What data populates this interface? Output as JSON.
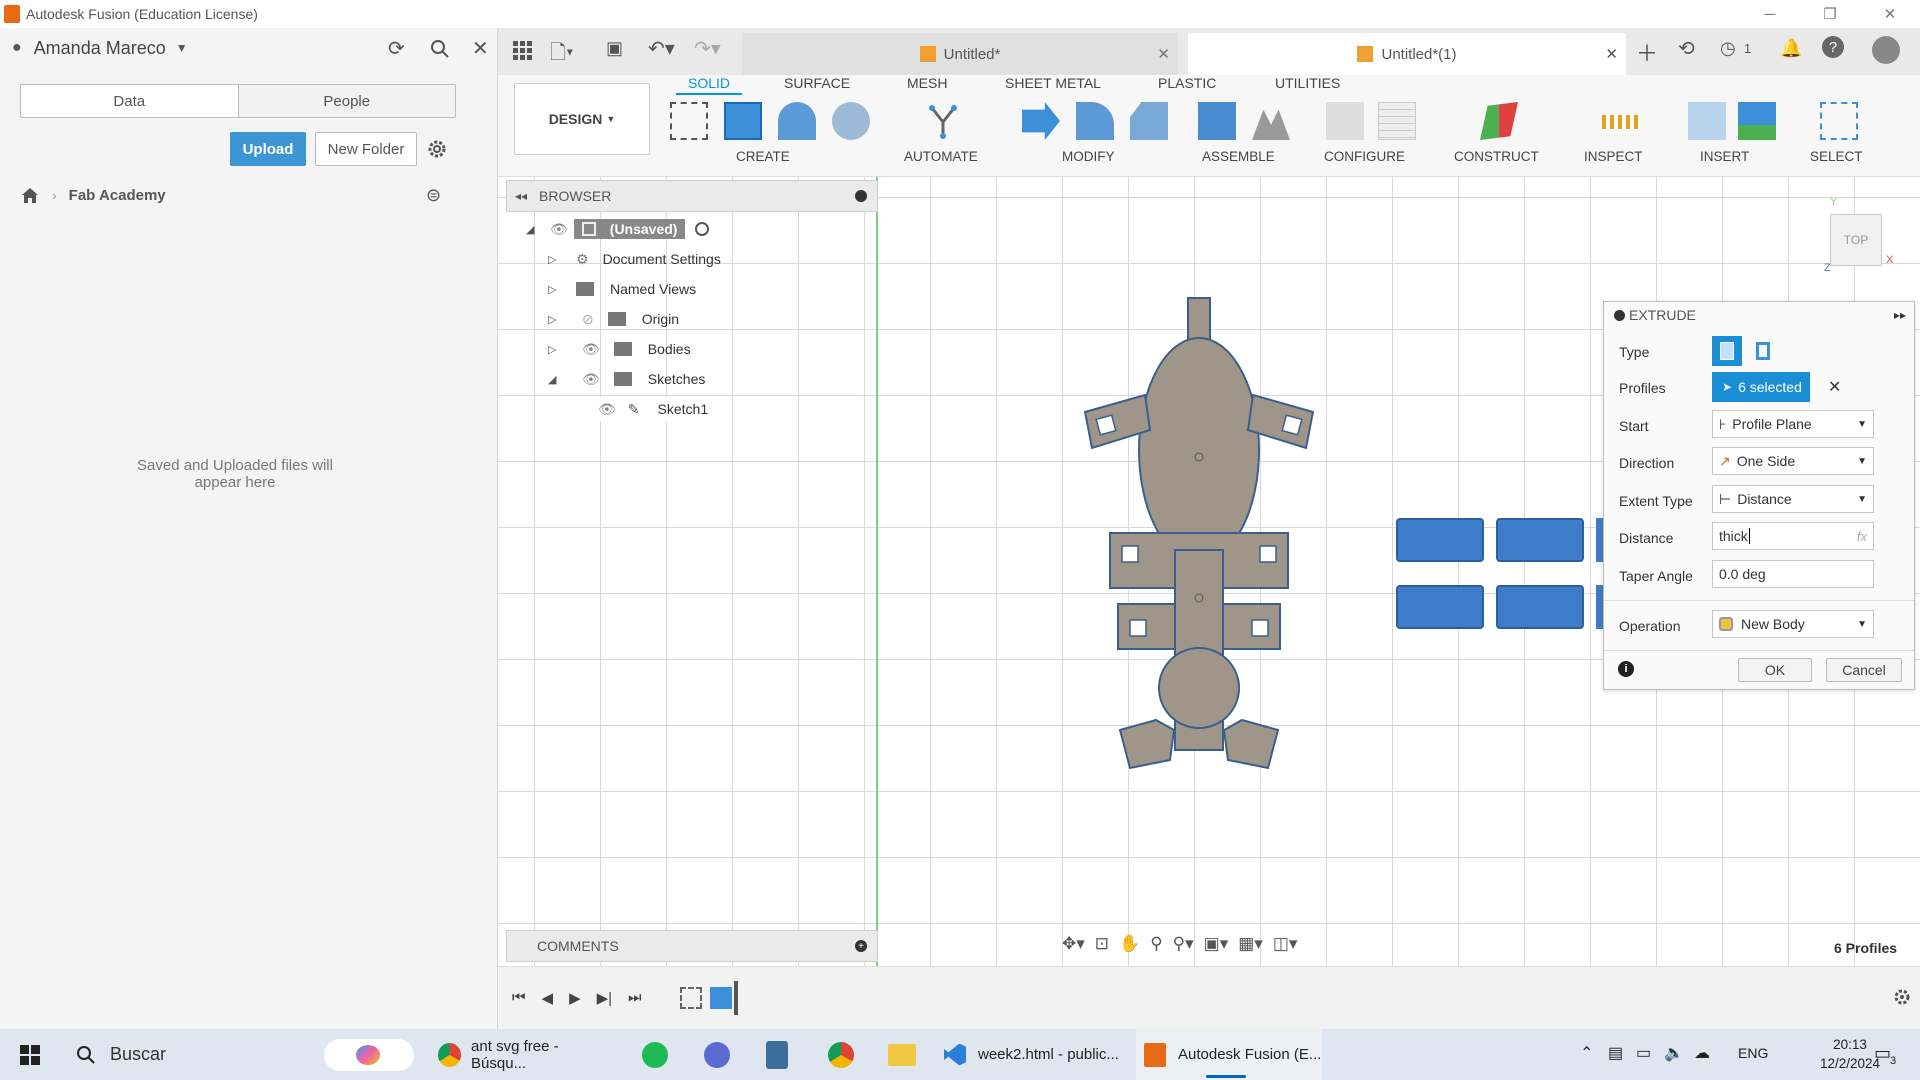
{
  "window": {
    "title": "Autodesk Fusion (Education License)"
  },
  "user": {
    "name": "Amanda Mareco"
  },
  "data_panel": {
    "tabs": [
      "Data",
      "People"
    ],
    "upload_label": "Upload",
    "new_folder_label": "New Folder",
    "breadcrumb": "Fab Academy",
    "empty_message_line1": "Saved and Uploaded files will",
    "empty_message_line2": "appear here"
  },
  "doc_tabs": [
    {
      "label": "Untitled*"
    },
    {
      "label": "Untitled*(1)"
    }
  ],
  "header_badges": {
    "jobs_count": "1"
  },
  "workspace": {
    "label": "DESIGN"
  },
  "ribbon": {
    "tabs": [
      "SOLID",
      "SURFACE",
      "MESH",
      "SHEET METAL",
      "PLASTIC",
      "UTILITIES"
    ],
    "groups": [
      "CREATE",
      "AUTOMATE",
      "MODIFY",
      "ASSEMBLE",
      "CONFIGURE",
      "CONSTRUCT",
      "INSPECT",
      "INSERT",
      "SELECT"
    ]
  },
  "browser": {
    "title": "BROWSER",
    "root": "(Unsaved)",
    "items": [
      "Document Settings",
      "Named Views",
      "Origin",
      "Bodies",
      "Sketches",
      "Sketch1"
    ]
  },
  "viewcube": {
    "label": "TOP",
    "axis_y": "Y",
    "axis_x": "X",
    "axis_z": "Z"
  },
  "extrude": {
    "title": "EXTRUDE",
    "labels": {
      "type": "Type",
      "profiles": "Profiles",
      "start": "Start",
      "direction": "Direction",
      "extent_type": "Extent Type",
      "distance": "Distance",
      "taper_angle": "Taper Angle",
      "operation": "Operation"
    },
    "profiles_value": "6 selected",
    "start_value": "Profile Plane",
    "direction_value": "One Side",
    "extent_type_value": "Distance",
    "distance_value": "thick",
    "distance_fx": "fx",
    "taper_angle_value": "0.0 deg",
    "operation_value": "New Body",
    "ok_label": "OK",
    "cancel_label": "Cancel"
  },
  "comments": {
    "title": "COMMENTS"
  },
  "status": {
    "profiles_count": "6 Profiles"
  },
  "taskbar": {
    "search_placeholder": "Buscar",
    "apps": [
      {
        "label": "ant svg free - Búsqu..."
      },
      {
        "label": "week2.html - public..."
      },
      {
        "label": "Autodesk Fusion (E..."
      }
    ],
    "language": "ENG",
    "time": "20:13",
    "date": "12/2/2024",
    "notification_count": "3"
  },
  "colors": {
    "accent": "#0696d7",
    "selected_blue": "#1a8ed4",
    "body_gray": "#9f9689",
    "profile_blue": "#3f7cc7",
    "taskbar_bg": "#dfe6ef"
  }
}
